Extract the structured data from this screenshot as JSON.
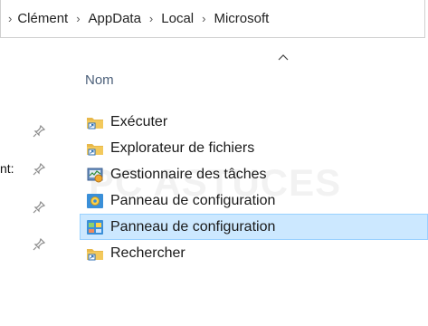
{
  "breadcrumb": {
    "items": [
      "Clément",
      "AppData",
      "Local",
      "Microsoft"
    ]
  },
  "list_header": {
    "column_name": "Nom"
  },
  "nav_pane": {
    "partial_label": "nt:"
  },
  "files": [
    {
      "name": "Exécuter",
      "icon": "shortcut-folder-icon"
    },
    {
      "name": "Explorateur de fichiers",
      "icon": "shortcut-folder-icon"
    },
    {
      "name": "Gestionnaire des tâches",
      "icon": "task-manager-icon"
    },
    {
      "name": "Panneau de configuration",
      "icon": "control-panel-icon"
    },
    {
      "name": "Panneau de configuration",
      "icon": "control-panel-icon",
      "selected": true
    },
    {
      "name": "Rechercher",
      "icon": "shortcut-folder-icon"
    }
  ],
  "watermark": "PC ASTUCES",
  "colors": {
    "selection_bg": "#cce8ff",
    "selection_border": "#99d1ff",
    "header_text": "#4c607a"
  }
}
